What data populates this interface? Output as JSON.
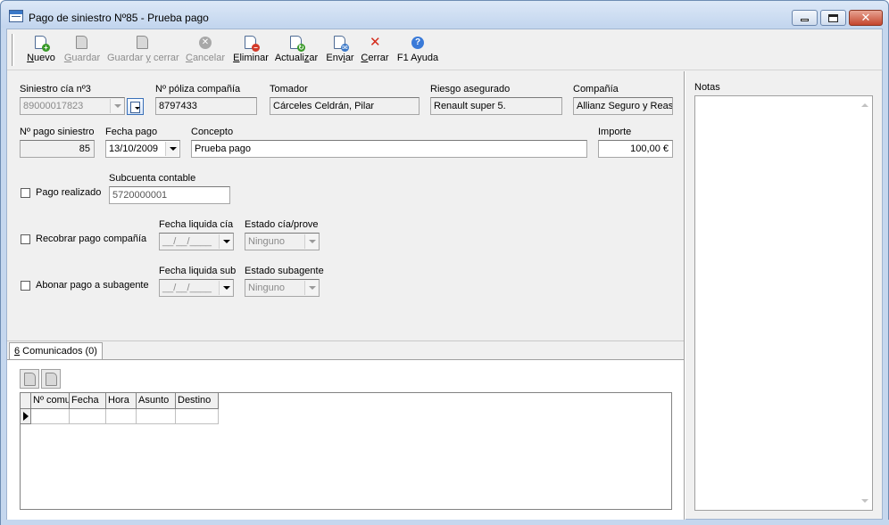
{
  "window": {
    "title": "Pago de siniestro Nº85 - Prueba pago"
  },
  "toolbar": {
    "nuevo": {
      "mn": "N",
      "rest": "uevo"
    },
    "guardar": {
      "mn": "G",
      "rest": "uardar"
    },
    "guardar_cerrar": {
      "a": "Guardar ",
      "mn": "y",
      "b": " cerrar"
    },
    "cancelar": {
      "mn": "C",
      "rest": "ancelar"
    },
    "eliminar": {
      "mn": "E",
      "rest": "liminar"
    },
    "actualizar": {
      "a": "Actuali",
      "mn": "z",
      "b": "ar"
    },
    "enviar": {
      "a": "Env",
      "mn": "i",
      "b": "ar"
    },
    "cerrar": {
      "mn": "C",
      "rest": "errar"
    },
    "ayuda": "F1 Ayuda"
  },
  "form": {
    "siniestro": {
      "label": "Siniestro cía nº3",
      "value": "89000017823"
    },
    "poliza": {
      "label": "Nº póliza compañía",
      "value": "8797433"
    },
    "tomador": {
      "label": "Tomador",
      "value": "Cárceles Celdrán, Pilar"
    },
    "riesgo": {
      "label": "Riesgo asegurado",
      "value": "Renault super 5."
    },
    "compania": {
      "label": "Compañía",
      "value": "Allianz Seguro y Rease"
    },
    "num_pago": {
      "label": "Nº pago siniestro",
      "value": "85"
    },
    "fecha_pago": {
      "label": "Fecha pago",
      "value": "13/10/2009"
    },
    "concepto": {
      "label": "Concepto",
      "value": "Prueba pago"
    },
    "importe": {
      "label": "Importe",
      "value": "100,00 €"
    },
    "pago_realizado": {
      "label": "Pago realizado"
    },
    "subcuenta": {
      "label": "Subcuenta contable",
      "value": "5720000001"
    },
    "recobrar": {
      "label": "Recobrar pago compañía"
    },
    "fecha_liquida_cia": {
      "label": "Fecha liquida cía",
      "value": "__/__/____"
    },
    "estado_cia": {
      "label": "Estado cía/prove",
      "value": "Ninguno"
    },
    "abonar": {
      "label": "Abonar pago a subagente"
    },
    "fecha_liquida_sub": {
      "label": "Fecha liquida sub",
      "value": "__/__/____"
    },
    "estado_sub": {
      "label": "Estado subagente",
      "value": "Ninguno"
    }
  },
  "tabs": {
    "comunicados": {
      "mn": "6",
      "rest": " Comunicados (0)"
    }
  },
  "grid": {
    "columns": [
      "Nº comu",
      "Fecha",
      "Hora",
      "Asunto",
      "Destino"
    ]
  },
  "notes": {
    "label": "Notas"
  }
}
